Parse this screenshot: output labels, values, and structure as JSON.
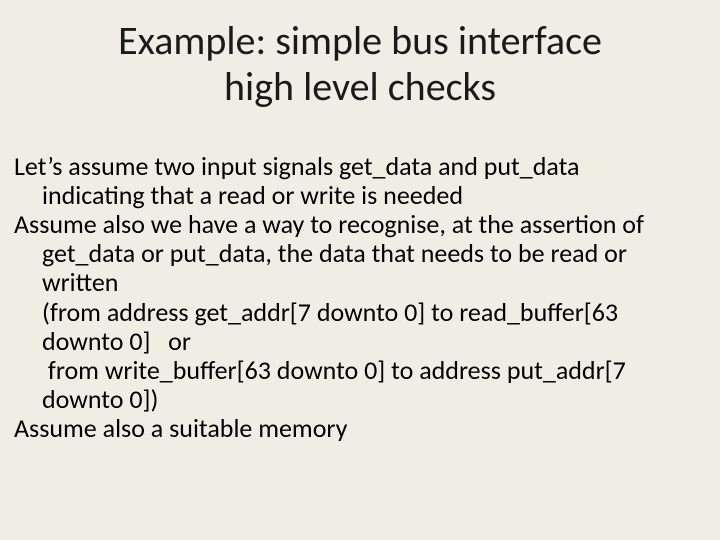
{
  "title": {
    "line1": "Example: simple bus interface",
    "line2": "high level checks"
  },
  "body": {
    "p1": "Let’s assume two input signals get_data and put_data indicating that a read or write is needed",
    "p2": "Assume also we have a way to recognise, at the assertion of get_data or put_data, the data that needs to be read or written",
    "p3": "(from address get_addr[7 downto 0] to read_buffer[63 downto 0]   or",
    "p4": " from write_buffer[63 downto 0] to address put_addr[7 downto 0])",
    "p5": "Assume also a suitable memory"
  }
}
